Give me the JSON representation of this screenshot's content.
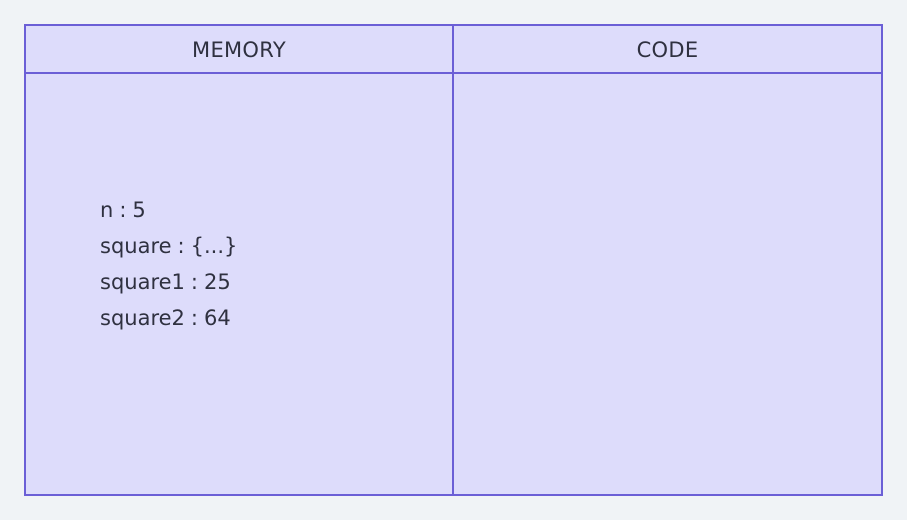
{
  "panels": {
    "memory": {
      "title": "MEMORY",
      "variables": [
        {
          "name": "n",
          "value": "5"
        },
        {
          "name": "square",
          "value": "{...}"
        },
        {
          "name": "square1",
          "value": "25"
        },
        {
          "name": "square2",
          "value": "64"
        }
      ]
    },
    "code": {
      "title": "CODE"
    }
  },
  "colors": {
    "border": "#6b5fd6",
    "panel_fill": "#dddcfb",
    "page_bg": "#f0f3f6",
    "text": "#2f3140"
  }
}
